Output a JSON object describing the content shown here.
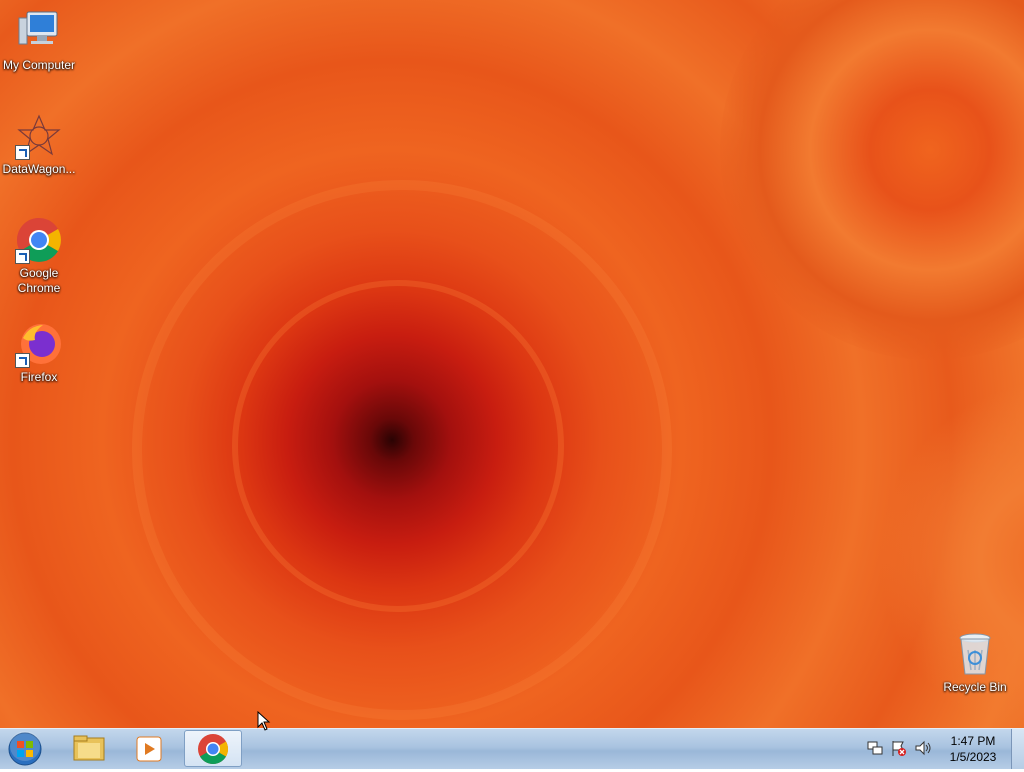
{
  "desktop": {
    "icons": [
      {
        "label": "My Computer",
        "icon": "computer-icon"
      },
      {
        "label": "DataWagon...",
        "icon": "datawagon-icon"
      },
      {
        "label": "Google Chrome",
        "icon": "chrome-icon"
      },
      {
        "label": "Firefox",
        "icon": "firefox-icon"
      },
      {
        "label": "Recycle Bin",
        "icon": "recycle-bin-icon"
      }
    ],
    "wallpaper_colors": {
      "center": "#5a0606",
      "mid": "#c81d10",
      "outer": "#ee6a24"
    }
  },
  "taskbar": {
    "start_icon": "windows-start-icon",
    "pinned": [
      {
        "icon": "file-explorer-icon"
      },
      {
        "icon": "media-player-icon"
      },
      {
        "icon": "chrome-icon",
        "active": true
      }
    ],
    "tray": {
      "icons": [
        "network-icon",
        "action-center-flag-icon",
        "volume-icon"
      ],
      "time": "1:47 PM",
      "date": "1/5/2023"
    },
    "colors": {
      "bar_top": "#c3d7ec",
      "bar_bottom": "#b6cde6"
    }
  }
}
